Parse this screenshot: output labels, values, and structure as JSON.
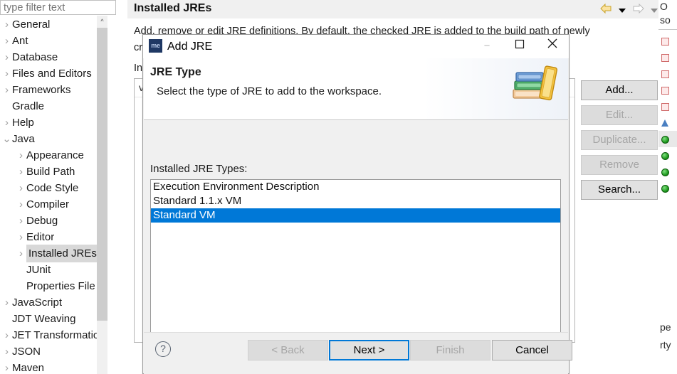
{
  "sidebar": {
    "filter_placeholder": "type filter text",
    "filter_value": "",
    "items": [
      {
        "label": "General",
        "level": 1,
        "twisty": "collapsed",
        "selected": false
      },
      {
        "label": "Ant",
        "level": 1,
        "twisty": "collapsed",
        "selected": false
      },
      {
        "label": "Database",
        "level": 1,
        "twisty": "collapsed",
        "selected": false
      },
      {
        "label": "Files and Editors",
        "level": 1,
        "twisty": "collapsed",
        "selected": false
      },
      {
        "label": "Frameworks",
        "level": 1,
        "twisty": "collapsed",
        "selected": false
      },
      {
        "label": "Gradle",
        "level": 1,
        "twisty": "none",
        "selected": false
      },
      {
        "label": "Help",
        "level": 1,
        "twisty": "collapsed",
        "selected": false
      },
      {
        "label": "Java",
        "level": 1,
        "twisty": "expanded",
        "selected": false
      },
      {
        "label": "Appearance",
        "level": 2,
        "twisty": "collapsed",
        "selected": false
      },
      {
        "label": "Build Path",
        "level": 2,
        "twisty": "collapsed",
        "selected": false
      },
      {
        "label": "Code Style",
        "level": 2,
        "twisty": "collapsed",
        "selected": false
      },
      {
        "label": "Compiler",
        "level": 2,
        "twisty": "collapsed",
        "selected": false
      },
      {
        "label": "Debug",
        "level": 2,
        "twisty": "collapsed",
        "selected": false
      },
      {
        "label": "Editor",
        "level": 2,
        "twisty": "collapsed",
        "selected": false
      },
      {
        "label": "Installed JREs",
        "level": 2,
        "twisty": "collapsed",
        "selected": true
      },
      {
        "label": "JUnit",
        "level": 2,
        "twisty": "none",
        "selected": false
      },
      {
        "label": "Properties File",
        "level": 2,
        "twisty": "none",
        "selected": false
      },
      {
        "label": "JavaScript",
        "level": 1,
        "twisty": "collapsed",
        "selected": false
      },
      {
        "label": "JDT Weaving",
        "level": 1,
        "twisty": "none",
        "selected": false
      },
      {
        "label": "JET Transformatio",
        "level": 1,
        "twisty": "collapsed",
        "selected": false
      },
      {
        "label": "JSON",
        "level": 1,
        "twisty": "collapsed",
        "selected": false
      },
      {
        "label": "Maven",
        "level": 1,
        "twisty": "collapsed",
        "selected": false
      }
    ]
  },
  "preference_page": {
    "title": "Installed JREs",
    "description_line1": "Add, remove or edit JRE definitions. By default, the checked JRE is added to the build path of newly",
    "description_line2": "created Java projects.",
    "sub_label": "Installed JREs:",
    "nav_icons": [
      "back-arrow-icon",
      "chevron-down-icon",
      "forward-arrow-icon",
      "chevron-down-icon",
      "chevron-down-icon"
    ],
    "obscured_row_text": "va",
    "side_buttons": [
      {
        "label": "Add...",
        "enabled": true
      },
      {
        "label": "Edit...",
        "enabled": false
      },
      {
        "label": "Duplicate...",
        "enabled": false
      },
      {
        "label": "Remove",
        "enabled": false
      },
      {
        "label": "Search...",
        "enabled": true
      }
    ]
  },
  "right_strip": {
    "top_partial_texts": [
      "O",
      "so"
    ],
    "markers": [
      {
        "icon": "red-square-marker",
        "highlighted": false
      },
      {
        "icon": "red-square-marker",
        "highlighted": false
      },
      {
        "icon": "red-square-marker",
        "highlighted": false
      },
      {
        "icon": "red-square-marker",
        "highlighted": false
      },
      {
        "icon": "red-square-marker",
        "highlighted": false
      },
      {
        "icon": "blue-triangle-marker",
        "highlighted": false
      },
      {
        "icon": "green-circle-marker",
        "highlighted": true
      },
      {
        "icon": "green-circle-marker",
        "highlighted": false
      },
      {
        "icon": "green-circle-marker",
        "highlighted": false
      },
      {
        "icon": "green-circle-marker",
        "highlighted": false
      }
    ],
    "bottom_partial_texts": [
      "pe",
      "rty"
    ]
  },
  "dialog": {
    "app_icon": "me-app-icon",
    "title": "Add JRE",
    "window_buttons": {
      "minimize": "−",
      "maximize": "❐",
      "close": "✕"
    },
    "heading": "JRE Type",
    "subheading": "Select the type of JRE to add to the workspace.",
    "banner_icon": "books-stack-icon",
    "list_label": "Installed JRE Types:",
    "list_items": [
      {
        "label": "Execution Environment Description",
        "selected": false
      },
      {
        "label": "Standard 1.1.x VM",
        "selected": false
      },
      {
        "label": "Standard VM",
        "selected": true
      }
    ],
    "help_icon": "question-mark-icon",
    "buttons": [
      {
        "id": "back",
        "label": "< Back",
        "enabled": false,
        "default": false
      },
      {
        "id": "next",
        "label": "Next >",
        "enabled": true,
        "default": true
      },
      {
        "id": "finish",
        "label": "Finish",
        "enabled": false,
        "default": false
      },
      {
        "id": "cancel",
        "label": "Cancel",
        "enabled": true,
        "default": false
      }
    ]
  },
  "colors": {
    "selection_blue": "#0078d7",
    "dialog_face": "#f0f0f0",
    "title_icon_navy": "#1f3864",
    "marker_green": "#1f9a1f",
    "marker_red": "#d06a6a"
  }
}
